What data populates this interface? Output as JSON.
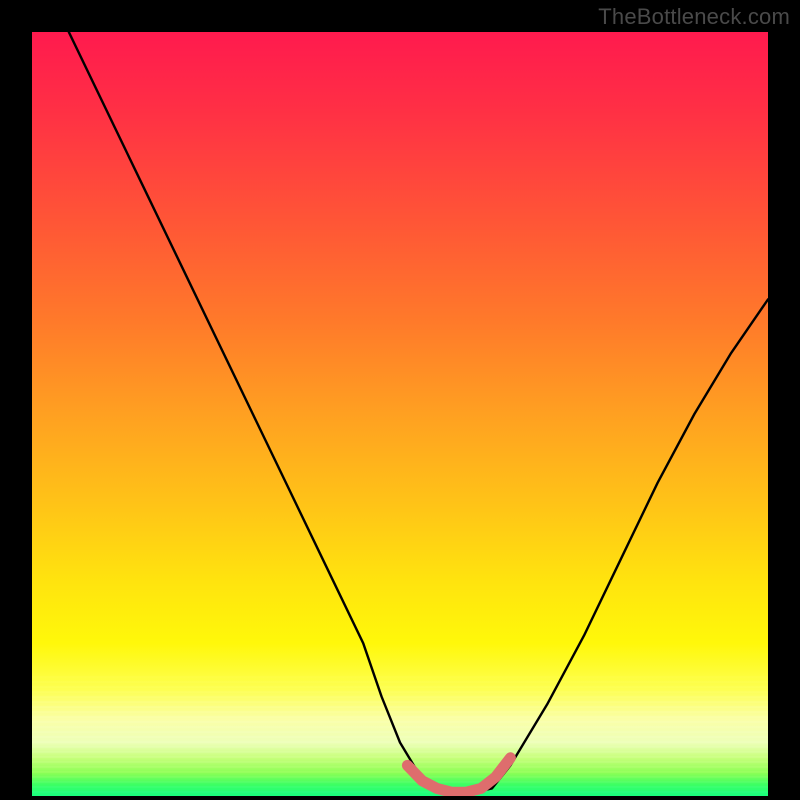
{
  "watermark": "TheBottleneck.com",
  "chart_data": {
    "type": "line",
    "title": "",
    "xlabel": "",
    "ylabel": "",
    "xlim": [
      0,
      100
    ],
    "ylim": [
      0,
      100
    ],
    "grid": false,
    "legend": false,
    "annotations": [],
    "series": [
      {
        "name": "bottleneck-curve",
        "x": [
          5,
          10,
          15,
          20,
          25,
          30,
          35,
          40,
          45,
          47.5,
          50,
          52.5,
          55,
          57.5,
          60,
          62.5,
          65,
          70,
          75,
          80,
          85,
          90,
          95,
          100
        ],
        "values": [
          100,
          90,
          80,
          70,
          60,
          50,
          40,
          30,
          20,
          13,
          7,
          3,
          1,
          0.5,
          0.5,
          1,
          4,
          12,
          21,
          31,
          41,
          50,
          58,
          65
        ]
      },
      {
        "name": "optimal-range-highlight",
        "x": [
          51,
          53,
          55,
          57,
          59,
          61,
          63,
          65
        ],
        "values": [
          4,
          2,
          1,
          0.5,
          0.5,
          1,
          2.5,
          5
        ]
      }
    ],
    "colors": {
      "curve": "#000000",
      "highlight": "#de6d6d",
      "gradient_top": "#ff1a4e",
      "gradient_mid": "#ffe40e",
      "gradient_bottom": "#18ff7e"
    }
  }
}
